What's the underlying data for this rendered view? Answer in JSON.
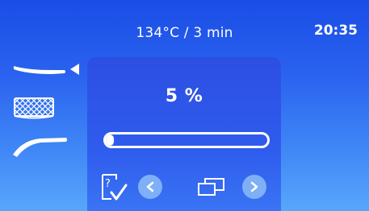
{
  "header": {
    "program": "134°C / 3 min",
    "time": "20:35"
  },
  "sidebar": {
    "items": [
      {
        "icon": "straight-handpiece-icon",
        "selected": true
      },
      {
        "icon": "basket-icon",
        "selected": false
      },
      {
        "icon": "contra-angle-handpiece-icon",
        "selected": false
      }
    ]
  },
  "main": {
    "progress_text": "5 %",
    "progress_fraction": 0.05
  },
  "toolbar": {
    "icons": [
      "help-checklist-icon",
      "previous-button",
      "windows-icon",
      "next-button"
    ],
    "prev_glyph": "<",
    "next_glyph": ">"
  },
  "colors": {
    "background_top": "#1a4de6",
    "background_bottom": "#58a6fb",
    "panel": "#2f5ced",
    "button": "#7fb0f7",
    "foreground": "#ffffff"
  }
}
